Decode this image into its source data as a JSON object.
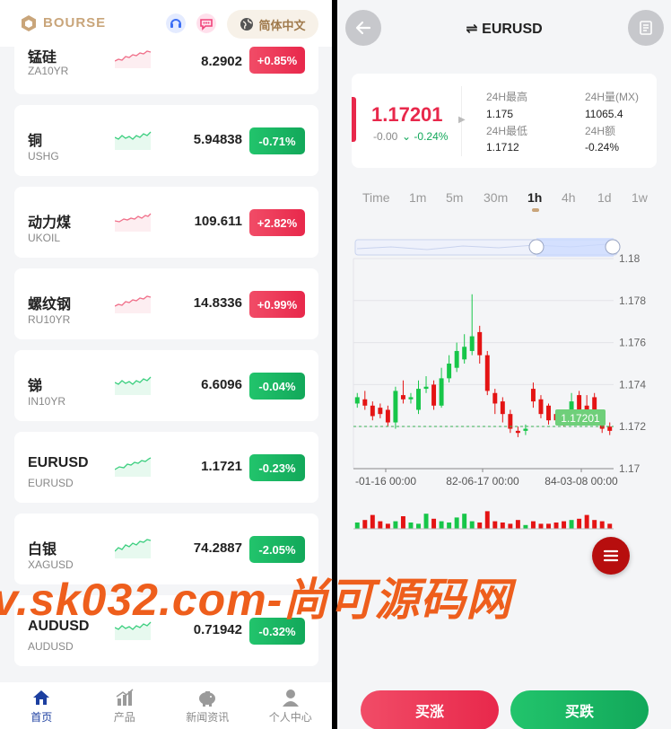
{
  "left": {
    "brand": "BOURSE",
    "lang_label": "简体中文",
    "list": [
      {
        "name": "锰硅",
        "code": "ZA10YR",
        "price": "8.2902",
        "change": "+0.85%",
        "dir": "up"
      },
      {
        "name": "铜",
        "code": "USHG",
        "price": "5.94838",
        "change": "-0.71%",
        "dir": "down"
      },
      {
        "name": "动力煤",
        "code": "UKOIL",
        "price": "109.611",
        "change": "+2.82%",
        "dir": "up"
      },
      {
        "name": "螺纹钢",
        "code": "RU10YR",
        "price": "14.8336",
        "change": "+0.99%",
        "dir": "up"
      },
      {
        "name": "锑",
        "code": "IN10YR",
        "price": "6.6096",
        "change": "-0.04%",
        "dir": "down"
      },
      {
        "name": "EURUSD",
        "code": "EURUSD",
        "price": "1.1721",
        "change": "-0.23%",
        "dir": "down"
      },
      {
        "name": "白银",
        "code": "XAGUSD",
        "price": "74.2887",
        "change": "-2.05%",
        "dir": "down"
      },
      {
        "name": "AUDUSD",
        "code": "AUDUSD",
        "price": "0.71942",
        "change": "-0.32%",
        "dir": "down"
      }
    ],
    "tabs": [
      {
        "label": "首页",
        "icon": "home-icon"
      },
      {
        "label": "产品",
        "icon": "chart-bars-icon"
      },
      {
        "label": "新闻资讯",
        "icon": "piggy-bank-icon"
      },
      {
        "label": "个人中心",
        "icon": "user-icon"
      }
    ]
  },
  "right": {
    "title_symbol": "⇌",
    "title": "EURUSD",
    "price": "1.17201",
    "change": "-0.00",
    "change_pct": "-0.24%",
    "stats": {
      "high_label": "24H最高",
      "high": "1.175",
      "low_label": "24H最低",
      "low": "1.1712",
      "vol_label": "24H量(MX)",
      "vol": "11065.4",
      "amt_label": "24H额",
      "amt": "-0.24%"
    },
    "periods": [
      "Time",
      "1m",
      "5m",
      "30m",
      "1h",
      "4h",
      "1d",
      "1w"
    ],
    "active_period": "1h",
    "buy_label": "买涨",
    "sell_label": "买跌",
    "colors": {
      "up": "#e8284b",
      "down": "#12a85a",
      "accent": "#c9a57a"
    }
  },
  "chart_data": {
    "type": "candlestick",
    "y_ticks": [
      "1.18",
      "1.178",
      "1.176",
      "1.174",
      "1.172",
      "1.17"
    ],
    "ylim": [
      1.17,
      1.18
    ],
    "x_ticks": [
      "-01-16 00:00",
      "82-06-17 00:00",
      "84-03-08 00:00"
    ],
    "last_price_label": "1.17201",
    "candles": [
      {
        "o": 1.1731,
        "c": 1.1734,
        "h": 1.1736,
        "l": 1.1729
      },
      {
        "o": 1.1733,
        "c": 1.173,
        "h": 1.1737,
        "l": 1.1728
      },
      {
        "o": 1.173,
        "c": 1.1725,
        "h": 1.1732,
        "l": 1.1723
      },
      {
        "o": 1.1729,
        "c": 1.1726,
        "h": 1.1731,
        "l": 1.1724
      },
      {
        "o": 1.1728,
        "c": 1.1722,
        "h": 1.173,
        "l": 1.172
      },
      {
        "o": 1.1722,
        "c": 1.1737,
        "h": 1.1739,
        "l": 1.1719
      },
      {
        "o": 1.1735,
        "c": 1.1733,
        "h": 1.1742,
        "l": 1.1731
      },
      {
        "o": 1.1733,
        "c": 1.1734,
        "h": 1.1736,
        "l": 1.1731
      },
      {
        "o": 1.1728,
        "c": 1.1738,
        "h": 1.1742,
        "l": 1.1726
      },
      {
        "o": 1.1738,
        "c": 1.1739,
        "h": 1.1744,
        "l": 1.1736
      },
      {
        "o": 1.174,
        "c": 1.173,
        "h": 1.1742,
        "l": 1.1728
      },
      {
        "o": 1.173,
        "c": 1.1743,
        "h": 1.1748,
        "l": 1.1729
      },
      {
        "o": 1.1743,
        "c": 1.175,
        "h": 1.1754,
        "l": 1.1741
      },
      {
        "o": 1.1748,
        "c": 1.1756,
        "h": 1.176,
        "l": 1.1746
      },
      {
        "o": 1.1752,
        "c": 1.1758,
        "h": 1.1764,
        "l": 1.175
      },
      {
        "o": 1.1756,
        "c": 1.1763,
        "h": 1.1783,
        "l": 1.1754
      },
      {
        "o": 1.1765,
        "c": 1.1754,
        "h": 1.1768,
        "l": 1.175
      },
      {
        "o": 1.1754,
        "c": 1.1737,
        "h": 1.1756,
        "l": 1.1735
      },
      {
        "o": 1.1736,
        "c": 1.1731,
        "h": 1.1738,
        "l": 1.1726
      },
      {
        "o": 1.1732,
        "c": 1.1726,
        "h": 1.1734,
        "l": 1.1722
      },
      {
        "o": 1.1726,
        "c": 1.1719,
        "h": 1.1728,
        "l": 1.1717
      },
      {
        "o": 1.1718,
        "c": 1.1717,
        "h": 1.172,
        "l": 1.1715
      },
      {
        "o": 1.1718,
        "c": 1.1719,
        "h": 1.1721,
        "l": 1.1716
      },
      {
        "o": 1.1738,
        "c": 1.1732,
        "h": 1.1741,
        "l": 1.1729
      },
      {
        "o": 1.1733,
        "c": 1.1726,
        "h": 1.1735,
        "l": 1.1724
      },
      {
        "o": 1.173,
        "c": 1.1723,
        "h": 1.1731,
        "l": 1.1721
      },
      {
        "o": 1.1726,
        "c": 1.1723,
        "h": 1.1727,
        "l": 1.1721
      },
      {
        "o": 1.1725,
        "c": 1.1722,
        "h": 1.1727,
        "l": 1.172
      },
      {
        "o": 1.1724,
        "c": 1.1732,
        "h": 1.1736,
        "l": 1.1722
      },
      {
        "o": 1.1735,
        "c": 1.1728,
        "h": 1.1737,
        "l": 1.1726
      },
      {
        "o": 1.173,
        "c": 1.1725,
        "h": 1.1735,
        "l": 1.1723
      },
      {
        "o": 1.1734,
        "c": 1.1728,
        "h": 1.1736,
        "l": 1.1726
      },
      {
        "o": 1.1726,
        "c": 1.1719,
        "h": 1.1728,
        "l": 1.1717
      },
      {
        "o": 1.172,
        "c": 1.1718,
        "h": 1.1722,
        "l": 1.1716
      }
    ],
    "volumes": [
      0.25,
      0.35,
      0.55,
      0.3,
      0.2,
      0.3,
      0.5,
      0.25,
      0.2,
      0.6,
      0.4,
      0.3,
      0.25,
      0.45,
      0.6,
      0.3,
      0.25,
      0.7,
      0.3,
      0.25,
      0.2,
      0.35,
      0.15,
      0.3,
      0.2,
      0.2,
      0.25,
      0.3,
      0.35,
      0.4,
      0.55,
      0.35,
      0.3,
      0.2
    ]
  }
}
